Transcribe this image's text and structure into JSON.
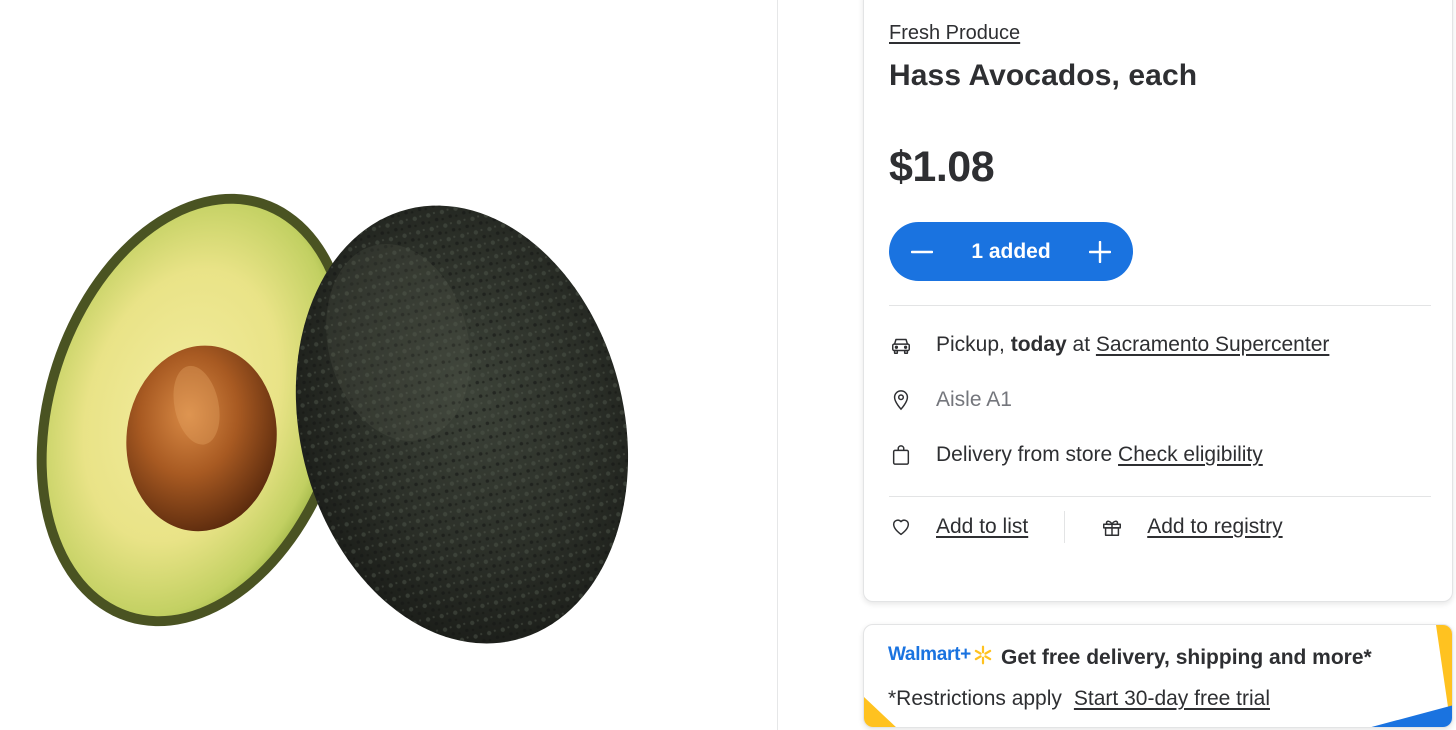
{
  "product": {
    "image_alt": "Hass avocado, one whole and one halved with pit",
    "breadcrumb": "Fresh Produce",
    "title": "Hass Avocados, each",
    "price": "$1.08"
  },
  "cart": {
    "quantity_label": "1 added",
    "decrement_icon": "minus-icon",
    "increment_icon": "plus-icon"
  },
  "fulfillment": {
    "pickup_prefix": "Pickup, ",
    "pickup_when": "today",
    "pickup_at": " at ",
    "pickup_store": "Sacramento Supercenter",
    "aisle": "Aisle A1",
    "delivery_text": "Delivery from store ",
    "delivery_link": "Check eligibility"
  },
  "actions": {
    "add_to_list": "Add to list",
    "add_to_registry": "Add to registry"
  },
  "promo": {
    "logo": "Walmart+",
    "headline": "Get free delivery, shipping and more*",
    "restrictions": "*Restrictions apply",
    "trial_link": "Start 30-day free trial"
  },
  "colors": {
    "primary_blue": "#1a73e0",
    "spark_yellow": "#ffc220",
    "text": "#2e2f32"
  }
}
